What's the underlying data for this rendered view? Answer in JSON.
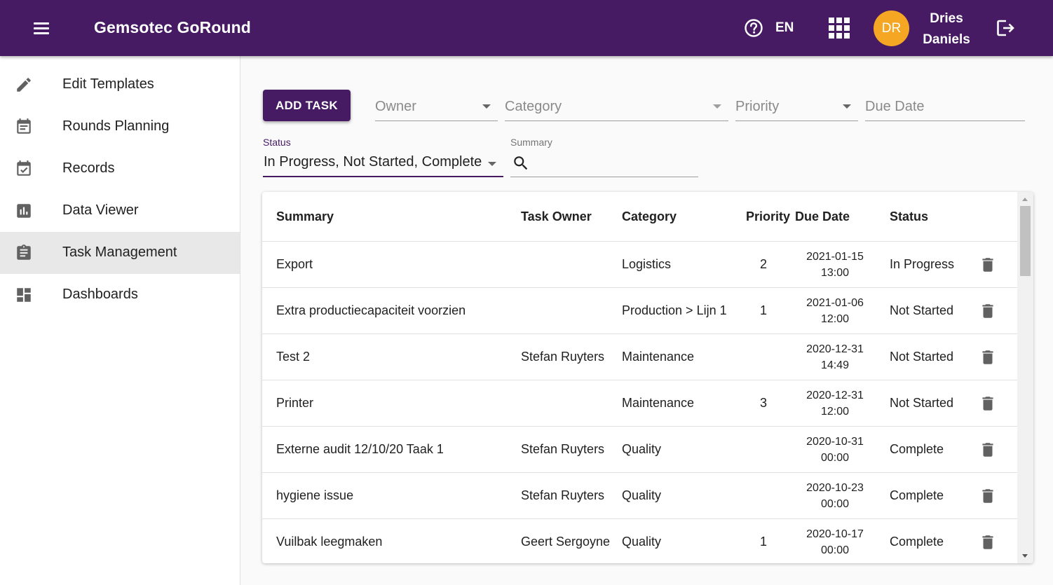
{
  "app": {
    "title": "Gemsotec GoRound",
    "language": "EN",
    "user_initials": "DR",
    "user_first": "Dries",
    "user_last": "Daniels",
    "brand_color": "#461b63",
    "avatar_color": "#f5a623"
  },
  "sidebar": {
    "items": [
      {
        "label": "Edit Templates",
        "icon": "pencil-icon"
      },
      {
        "label": "Rounds Planning",
        "icon": "calendar-icon"
      },
      {
        "label": "Records",
        "icon": "calendar-check-icon"
      },
      {
        "label": "Data Viewer",
        "icon": "bar-chart-icon"
      },
      {
        "label": "Task Management",
        "icon": "clipboard-icon",
        "active": true
      },
      {
        "label": "Dashboards",
        "icon": "dashboard-icon"
      }
    ]
  },
  "filters": {
    "add_task_label": "ADD TASK",
    "owner_placeholder": "Owner",
    "category_placeholder": "Category",
    "priority_placeholder": "Priority",
    "due_date_placeholder": "Due Date",
    "status_label": "Status",
    "status_value": "In Progress, Not Started, Complete",
    "summary_label": "Summary",
    "summary_value": ""
  },
  "table": {
    "headers": {
      "summary": "Summary",
      "owner": "Task Owner",
      "category": "Category",
      "priority": "Priority",
      "due_date": "Due Date",
      "status": "Status"
    },
    "rows": [
      {
        "summary": "Export",
        "owner": "",
        "category": "Logistics",
        "priority": "2",
        "due_date": "2021-01-15",
        "due_time": "13:00",
        "status": "In Progress"
      },
      {
        "summary": "Extra productiecapaciteit voorzien",
        "owner": "",
        "category": "Production > Lijn 1",
        "priority": "1",
        "due_date": "2021-01-06",
        "due_time": "12:00",
        "status": "Not Started"
      },
      {
        "summary": "Test 2",
        "owner": "Stefan Ruyters",
        "category": "Maintenance",
        "priority": "",
        "due_date": "2020-12-31",
        "due_time": "14:49",
        "status": "Not Started"
      },
      {
        "summary": "Printer",
        "owner": "",
        "category": "Maintenance",
        "priority": "3",
        "due_date": "2020-12-31",
        "due_time": "12:00",
        "status": "Not Started"
      },
      {
        "summary": "Externe audit 12/10/20 Taak 1",
        "owner": "Stefan Ruyters",
        "category": "Quality",
        "priority": "",
        "due_date": "2020-10-31",
        "due_time": "00:00",
        "status": "Complete"
      },
      {
        "summary": "hygiene issue",
        "owner": "Stefan Ruyters",
        "category": "Quality",
        "priority": "",
        "due_date": "2020-10-23",
        "due_time": "00:00",
        "status": "Complete"
      },
      {
        "summary": "Vuilbak leegmaken",
        "owner": "Geert Sergoyne",
        "category": "Quality",
        "priority": "1",
        "due_date": "2020-10-17",
        "due_time": "00:00",
        "status": "Complete"
      }
    ]
  }
}
